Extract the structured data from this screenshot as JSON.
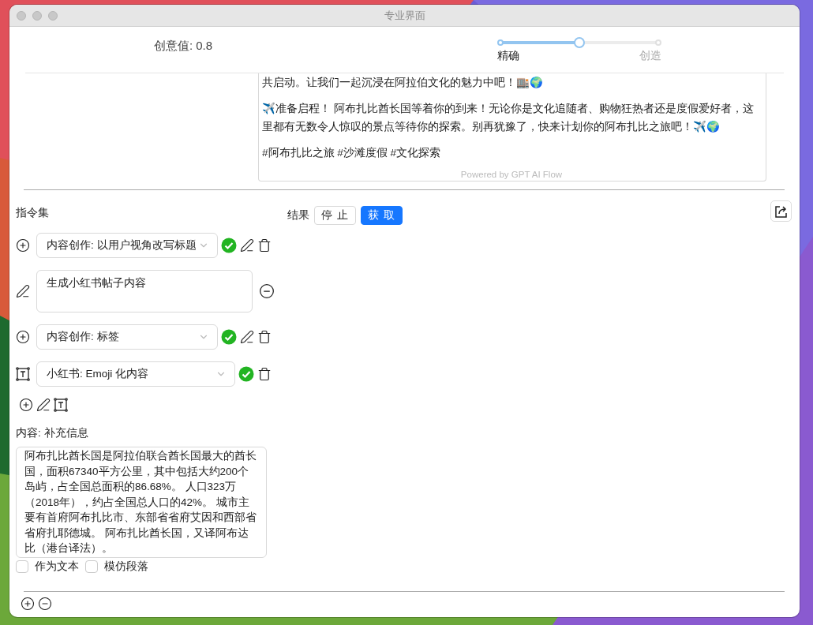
{
  "window": {
    "title": "专业界面"
  },
  "creativity": {
    "label": "创意值: 0.8",
    "level": 0.5,
    "marks": [
      {
        "label": "精确",
        "selected": true
      },
      {
        "label": "创造",
        "selected": false
      }
    ]
  },
  "result_box": {
    "paragraphs": [
      "共启动。让我们一起沉浸在阿拉伯文化的魅力中吧！🏬🌍",
      "✈️准备启程！ 阿布扎比酋长国等着你的到来！无论你是文化追随者、购物狂热者还是度假爱好者，这里都有无数令人惊叹的景点等待你的探索。别再犹豫了，快来计划你的阿布扎比之旅吧！✈️🌍",
      "#阿布扎比之旅 #沙滩度假 #文化探索"
    ],
    "footer": "Powered by GPT AI Flow"
  },
  "instructions": {
    "title": "指令集",
    "items": [
      {
        "kind": "prompt",
        "value": "内容创作: 以用户视角改写标题"
      },
      {
        "kind": "edit",
        "value": "生成小红书帖子内容"
      },
      {
        "kind": "prompt",
        "value": "内容创作: 标签"
      },
      {
        "kind": "format",
        "value": "小红书: Emoji 化内容"
      }
    ]
  },
  "result_bar": {
    "label": "结果",
    "buttons": [
      {
        "label": "停 止",
        "kind": "default"
      },
      {
        "label": "获 取",
        "kind": "primary"
      }
    ]
  },
  "content": {
    "label": "内容: 补充信息",
    "value": "阿布扎比酋长国是阿拉伯联合酋长国最大的酋长国，面积67340平方公里，其中包括大约200个岛屿，占全国总面积的86.68%。 人口323万（2018年），约占全国总人口的42%。 城市主要有首府阿布扎比市、东部省省府艾因和西部省省府扎耶德城。 阿布扎比酋长国，又译阿布达比（港台译法）。",
    "options": [
      {
        "label": "作为文本",
        "checked": false
      },
      {
        "label": "模仿段落",
        "checked": false
      }
    ]
  }
}
